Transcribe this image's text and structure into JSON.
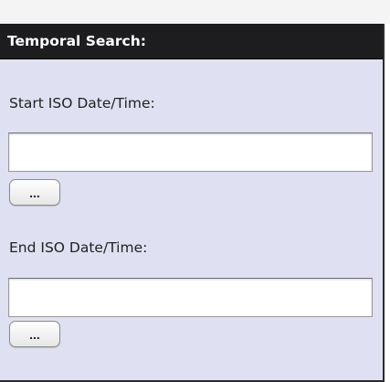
{
  "panel": {
    "title": "Temporal Search:",
    "start": {
      "label": "Start ISO Date/Time:",
      "value": "",
      "button_label": "..."
    },
    "end": {
      "label": "End ISO Date/Time:",
      "value": "",
      "button_label": "..."
    }
  },
  "colors": {
    "header_bg": "#1d1d1f",
    "panel_bg": "#dfe1f2",
    "border": "#2a2a2a"
  }
}
